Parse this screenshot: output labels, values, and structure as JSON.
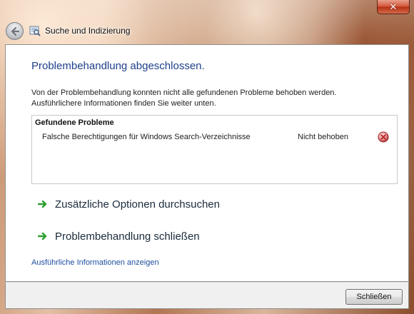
{
  "window": {
    "title": "Suche und Indizierung",
    "close_glyph": "✕",
    "title_icon": "search-indexing-icon",
    "back_icon": "back-arrow-icon"
  },
  "main": {
    "heading": "Problembehandlung abgeschlossen.",
    "description_lines": [
      "Von der Problembehandlung konnten nicht alle gefundenen Probleme behoben werden.",
      "Ausführlichere Informationen finden Sie weiter unten."
    ],
    "problems": {
      "header": "Gefundene Probleme",
      "items": [
        {
          "name": "Falsche Berechtigungen für Windows Search-Verzeichnisse",
          "status": "Nicht behoben",
          "status_icon": "error-icon"
        }
      ]
    },
    "options": [
      {
        "label": "Zusätzliche Optionen durchsuchen",
        "icon": "green-arrow-icon"
      },
      {
        "label": "Problembehandlung schließen",
        "icon": "green-arrow-icon"
      }
    ],
    "details_link": "Ausführliche Informationen anzeigen"
  },
  "footer": {
    "close_button": "Schließen"
  },
  "colors": {
    "heading": "#1e3f8a",
    "link": "#1e4fa0",
    "option_arrow": "#2ea02e",
    "error": "#c0282a",
    "titlebar_close": "#c8452a"
  }
}
